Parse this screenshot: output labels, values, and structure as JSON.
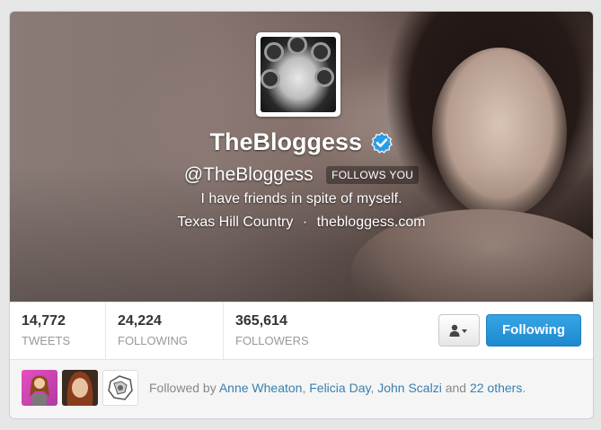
{
  "profile": {
    "display_name": "TheBloggess",
    "handle": "@TheBloggess",
    "follows_you_badge": "FOLLOWS YOU",
    "bio": "I have friends in spite of myself.",
    "location": "Texas Hill Country",
    "separator": "·",
    "website": "thebloggess.com"
  },
  "stats": {
    "tweets": {
      "value": "14,772",
      "label": "TWEETS"
    },
    "following": {
      "value": "24,224",
      "label": "FOLLOWING"
    },
    "followers": {
      "value": "365,614",
      "label": "FOLLOWERS"
    }
  },
  "actions": {
    "following_button": "Following",
    "user_menu_icon": "user-dropdown-icon"
  },
  "followed_by": {
    "prefix": "Followed by",
    "names": [
      "Anne Wheaton",
      "Felicia Day",
      "John Scalzi"
    ],
    "comma": ",",
    "and_text": "and",
    "others_link": "22 others",
    "suffix": "."
  },
  "colors": {
    "accent": "#2b8fd6",
    "link": "#3a7fae",
    "verified": "#2b9ce8"
  }
}
